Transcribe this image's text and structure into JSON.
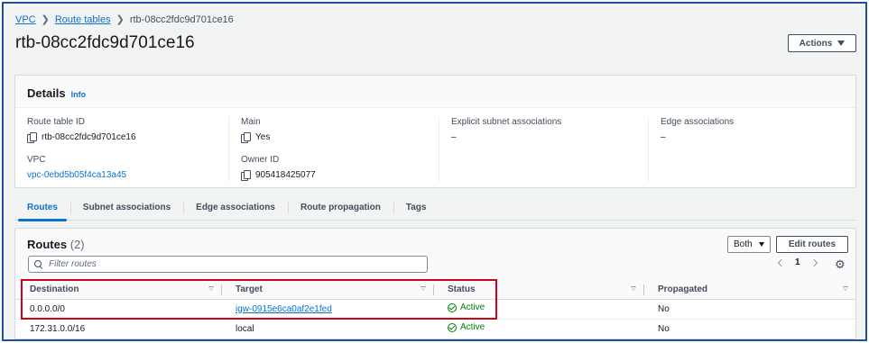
{
  "breadcrumb": {
    "items": [
      "VPC",
      "Route tables"
    ],
    "current": "rtb-08cc2fdc9d701ce16"
  },
  "page": {
    "title": "rtb-08cc2fdc9d701ce16",
    "actions_label": "Actions"
  },
  "details": {
    "title": "Details",
    "info": "Info",
    "route_table_id_label": "Route table ID",
    "route_table_id": "rtb-08cc2fdc9d701ce16",
    "vpc_label": "VPC",
    "vpc": "vpc-0ebd5b05f4ca13a45",
    "main_label": "Main",
    "main": "Yes",
    "owner_id_label": "Owner ID",
    "owner_id": "905418425077",
    "explicit_label": "Explicit subnet associations",
    "explicit": "–",
    "edge_label": "Edge associations",
    "edge": "–"
  },
  "tabs": [
    "Routes",
    "Subnet associations",
    "Edge associations",
    "Route propagation",
    "Tags"
  ],
  "routes": {
    "title": "Routes",
    "count": "(2)",
    "select_value": "Both",
    "edit_label": "Edit routes",
    "filter_placeholder": "Filter routes",
    "page": "1",
    "columns": [
      "Destination",
      "Target",
      "Status",
      "Propagated"
    ],
    "rows": [
      {
        "destination": "0.0.0.0/0",
        "target": "igw-0915e6ca0af2e1fed",
        "status": "Active",
        "propagated": "No"
      },
      {
        "destination": "172.31.0.0/16",
        "target": "local",
        "status": "Active",
        "propagated": "No"
      }
    ]
  },
  "colors": {
    "link": "#0972d3",
    "active": "#037f0c",
    "highlight": "#d0021b",
    "frame": "#1f4e9a"
  },
  "icons": [
    "copy-icon",
    "search-icon",
    "gear-icon",
    "check-circle-icon",
    "chevron-left-icon",
    "chevron-right-icon",
    "caret-down-icon",
    "sort-icon"
  ]
}
